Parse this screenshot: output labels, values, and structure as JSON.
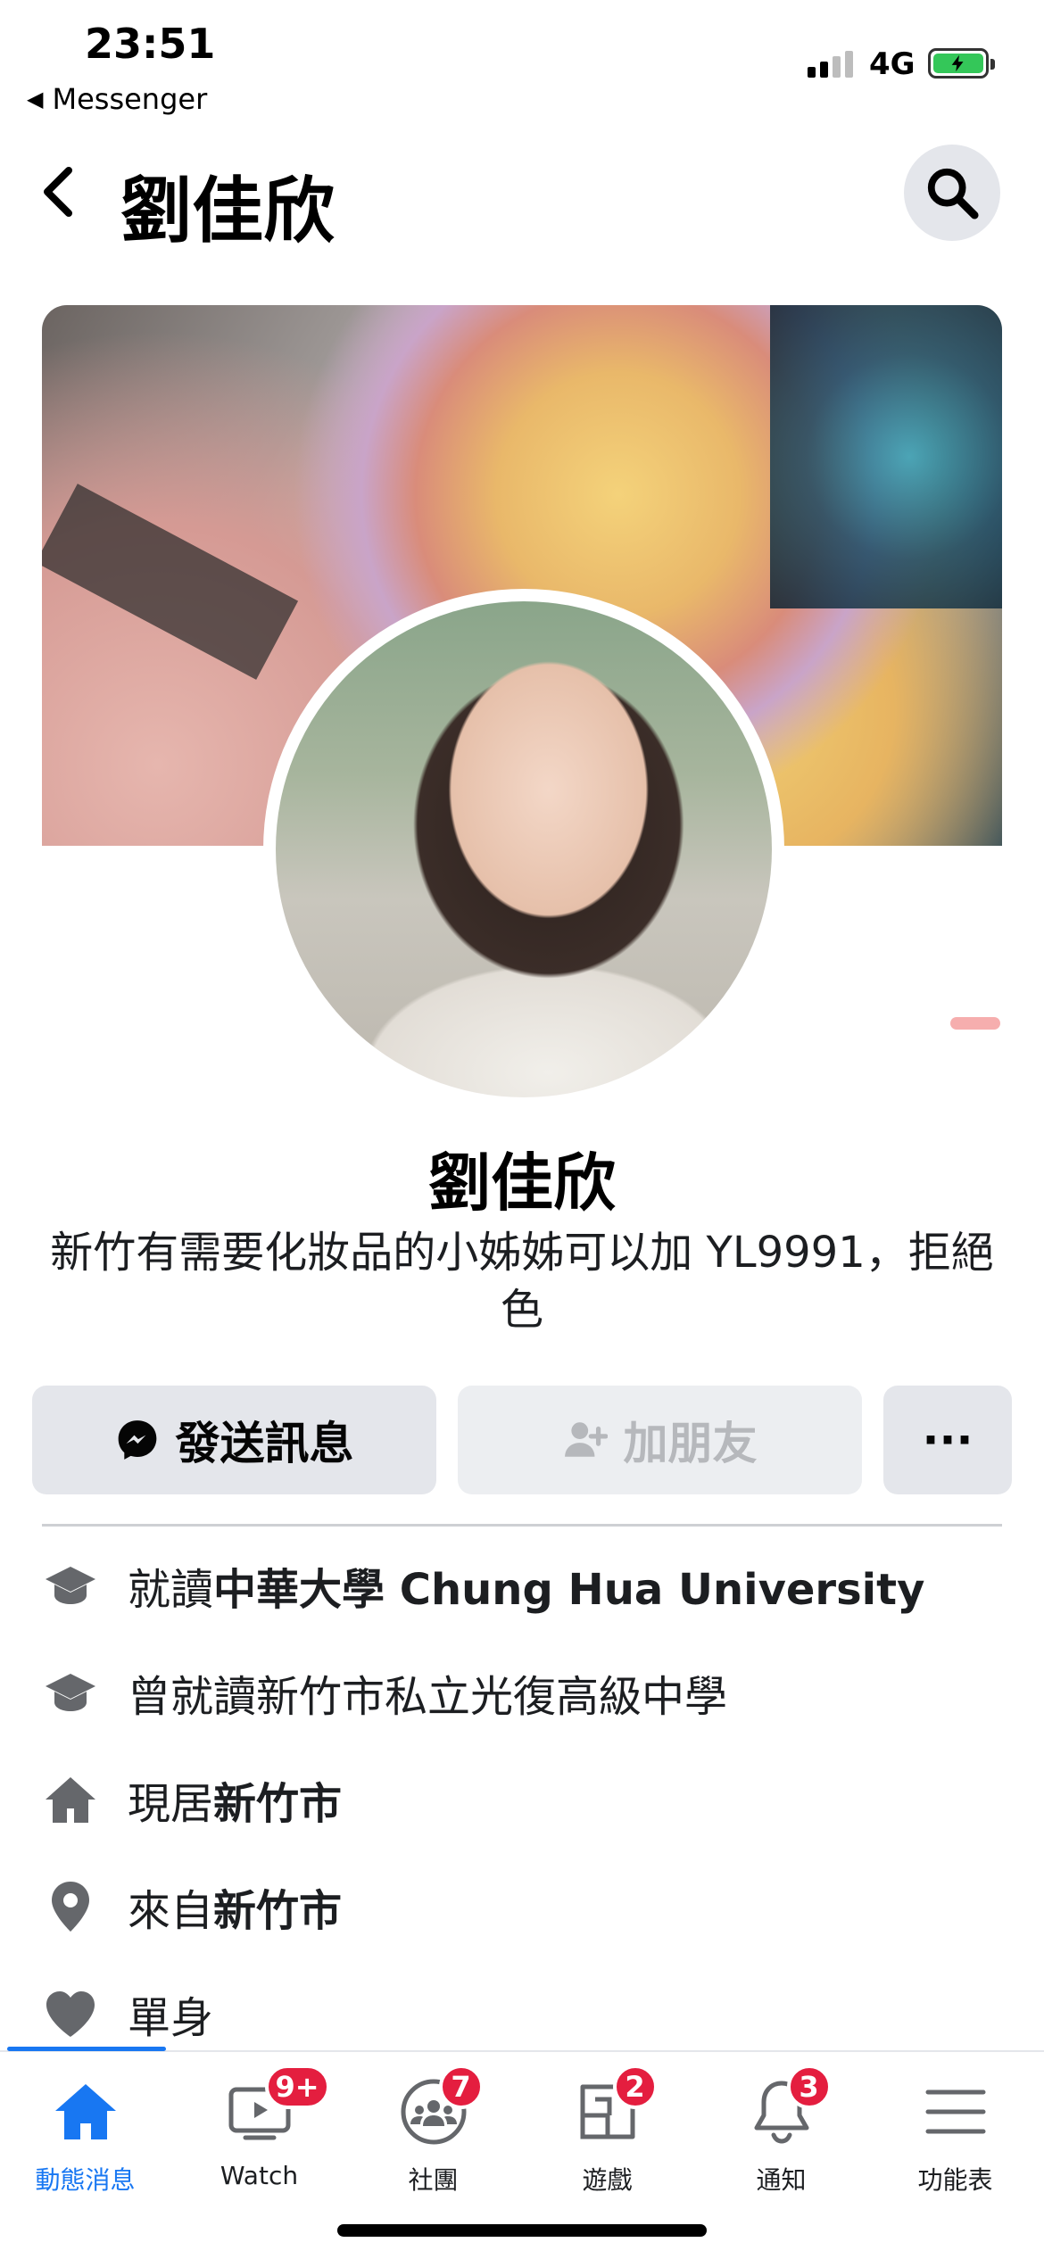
{
  "status_bar": {
    "time": "23:51",
    "back_app": "Messenger",
    "network": "4G",
    "signal_bars": 2,
    "battery": "charging"
  },
  "header": {
    "title": "劉佳欣",
    "back_icon": "chevron-left-icon",
    "search_icon": "search-icon"
  },
  "profile": {
    "name": "劉佳欣",
    "bio": "新竹有需要化妝品的小姊姊可以加 YL9991，拒絕色"
  },
  "actions": {
    "message_label": "發送訊息",
    "add_friend_label": "加朋友",
    "more_label": "···"
  },
  "details": [
    {
      "prefix": "就讀",
      "bold": "中華大學 Chung Hua University",
      "icon": "graduation-cap-icon"
    },
    {
      "prefix": "曾就讀新竹市私立光復高級中學",
      "bold": "",
      "icon": "graduation-cap-icon"
    },
    {
      "prefix": "現居",
      "bold": "新竹市",
      "icon": "home-icon"
    },
    {
      "prefix": "來自",
      "bold": "新竹市",
      "icon": "location-pin-icon"
    },
    {
      "prefix": "單身",
      "bold": "",
      "icon": "heart-icon"
    }
  ],
  "tabs": [
    {
      "label": "動態消息",
      "badge": "",
      "active": true,
      "icon": "home-icon"
    },
    {
      "label": "Watch",
      "badge": "9+",
      "active": false,
      "icon": "watch-video-icon"
    },
    {
      "label": "社團",
      "badge": "7",
      "active": false,
      "icon": "groups-icon"
    },
    {
      "label": "遊戲",
      "badge": "2",
      "active": false,
      "icon": "gaming-icon"
    },
    {
      "label": "通知",
      "badge": "3",
      "active": false,
      "icon": "bell-icon"
    },
    {
      "label": "功能表",
      "badge": "",
      "active": false,
      "icon": "menu-icon"
    }
  ],
  "colors": {
    "accent": "#1877f2",
    "badge": "#e41e3f",
    "button_bg": "#e4e6eb",
    "icon_gray": "#65676b"
  }
}
